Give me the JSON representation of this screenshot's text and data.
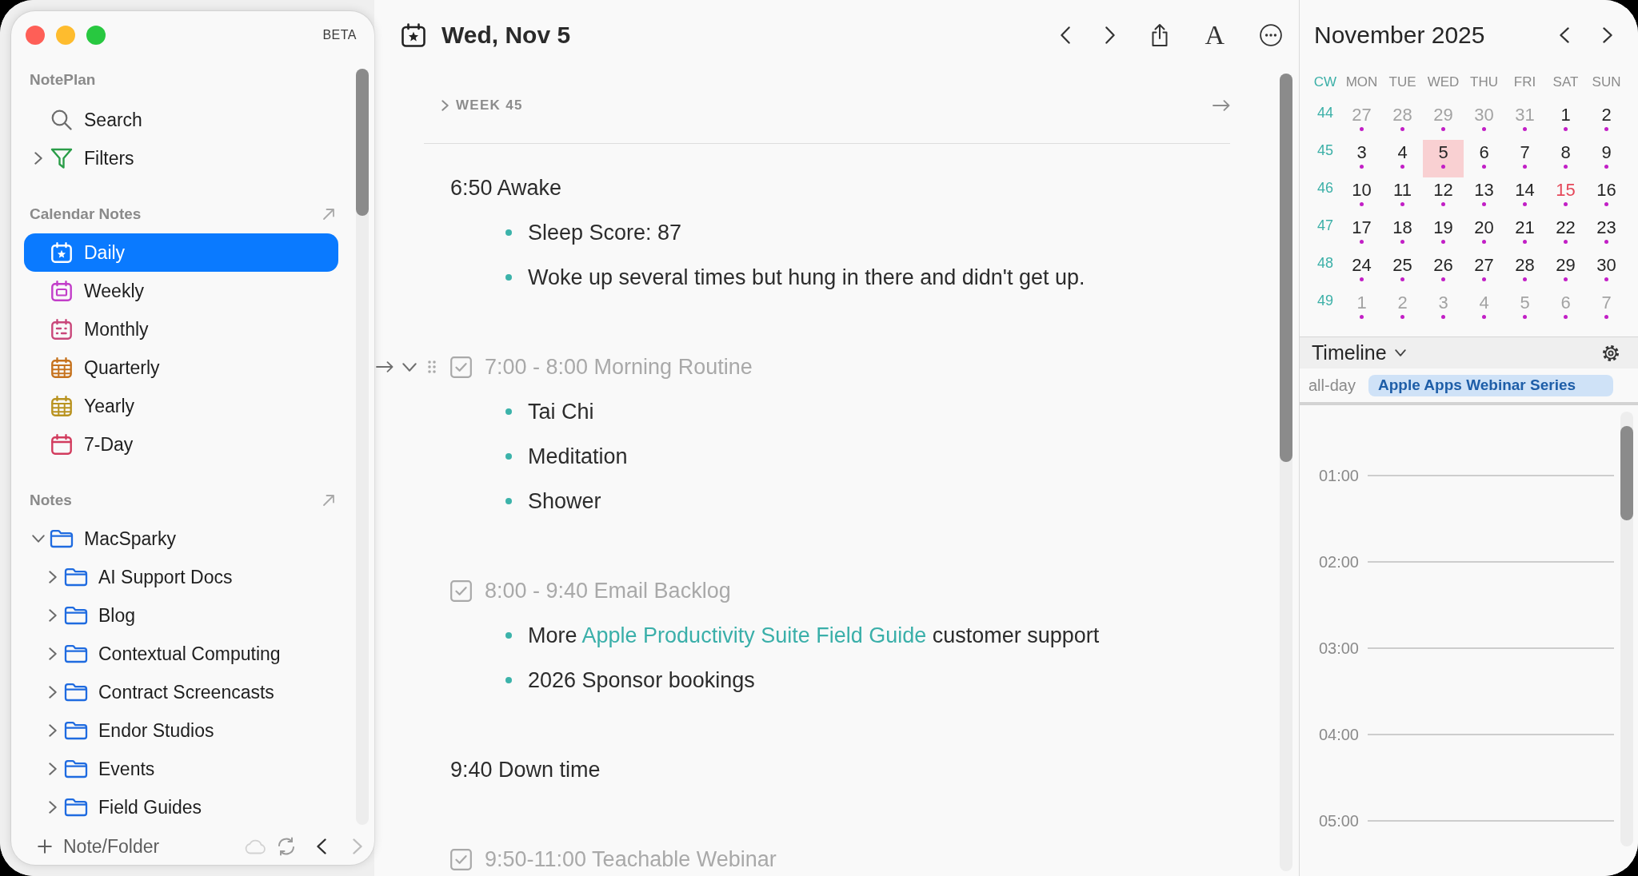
{
  "sidebar": {
    "badge": "BETA",
    "app_section": {
      "title": "NotePlan",
      "items": [
        {
          "kind": "search",
          "label": "Search"
        },
        {
          "kind": "filters",
          "label": "Filters",
          "expanded": false
        }
      ]
    },
    "calendar_notes": {
      "title": "Calendar Notes",
      "items": [
        {
          "kind": "daily",
          "label": "Daily",
          "selected": true
        },
        {
          "kind": "weekly",
          "label": "Weekly",
          "selected": false
        },
        {
          "kind": "monthly",
          "label": "Monthly",
          "selected": false
        },
        {
          "kind": "quarterly",
          "label": "Quarterly",
          "selected": false
        },
        {
          "kind": "yearly",
          "label": "Yearly",
          "selected": false
        },
        {
          "kind": "seven_day",
          "label": "7-Day",
          "selected": false
        }
      ]
    },
    "notes": {
      "title": "Notes",
      "folders": [
        {
          "label": "MacSparky",
          "expanded": true,
          "children": [
            {
              "label": "AI Support Docs",
              "expanded": false
            },
            {
              "label": "Blog",
              "expanded": false
            },
            {
              "label": "Contextual Computing",
              "expanded": false
            },
            {
              "label": "Contract Screencasts",
              "expanded": false
            },
            {
              "label": "Endor Studios",
              "expanded": false
            },
            {
              "label": "Events",
              "expanded": false
            },
            {
              "label": "Field Guides",
              "expanded": false
            }
          ]
        }
      ]
    },
    "footer": {
      "add_label": "Note/Folder",
      "back_disabled": false,
      "forward_disabled": true
    }
  },
  "note": {
    "title": "Wed, Nov 5",
    "format_glyph": "A",
    "week": {
      "label": "WEEK 45",
      "expanded": false
    },
    "sections": [
      {
        "kind": "text",
        "text": "6:50 Awake",
        "hovered": false,
        "bullets": [
          {
            "text": "Sleep Score: 87"
          },
          {
            "text": "Woke up several times but hung in there and didn't get up."
          }
        ]
      },
      {
        "kind": "task",
        "text": "7:00 - 8:00 Morning Routine",
        "checked": true,
        "hovered": true,
        "bullets": [
          {
            "text": "Tai Chi"
          },
          {
            "text": "Meditation"
          },
          {
            "text": "Shower"
          }
        ]
      },
      {
        "kind": "task",
        "text": "8:00 - 9:40 Email Backlog",
        "checked": true,
        "hovered": false,
        "bullets": [
          {
            "text": "More",
            "link": "Apple Productivity Suite Field Guide",
            "after": "customer support"
          },
          {
            "text": "2026 Sponsor bookings"
          }
        ]
      },
      {
        "kind": "text",
        "text": "9:40 Down time",
        "hovered": false
      },
      {
        "kind": "task",
        "text": "9:50-11:00 Teachable Webinar",
        "checked": true,
        "hovered": false
      }
    ]
  },
  "calendar": {
    "title": "November 2025",
    "week_column_label": "CW",
    "weekdays": [
      "MON",
      "TUE",
      "WED",
      "THU",
      "FRI",
      "SAT",
      "SUN"
    ],
    "weeks": [
      {
        "cw": "44",
        "days": [
          {
            "day": "27",
            "outside_month": true,
            "selected": false,
            "today": false,
            "dot": true
          },
          {
            "day": "28",
            "outside_month": true,
            "selected": false,
            "today": false,
            "dot": true
          },
          {
            "day": "29",
            "outside_month": true,
            "selected": false,
            "today": false,
            "dot": true
          },
          {
            "day": "30",
            "outside_month": true,
            "selected": false,
            "today": false,
            "dot": true
          },
          {
            "day": "31",
            "outside_month": true,
            "selected": false,
            "today": false,
            "dot": true
          },
          {
            "day": "1",
            "outside_month": false,
            "selected": false,
            "today": false,
            "dot": true
          },
          {
            "day": "2",
            "outside_month": false,
            "selected": false,
            "today": false,
            "dot": true
          }
        ]
      },
      {
        "cw": "45",
        "days": [
          {
            "day": "3",
            "outside_month": false,
            "selected": false,
            "today": false,
            "dot": true
          },
          {
            "day": "4",
            "outside_month": false,
            "selected": false,
            "today": false,
            "dot": true
          },
          {
            "day": "5",
            "outside_month": false,
            "selected": true,
            "today": false,
            "dot": true
          },
          {
            "day": "6",
            "outside_month": false,
            "selected": false,
            "today": false,
            "dot": true
          },
          {
            "day": "7",
            "outside_month": false,
            "selected": false,
            "today": false,
            "dot": true
          },
          {
            "day": "8",
            "outside_month": false,
            "selected": false,
            "today": false,
            "dot": true
          },
          {
            "day": "9",
            "outside_month": false,
            "selected": false,
            "today": false,
            "dot": true
          }
        ]
      },
      {
        "cw": "46",
        "days": [
          {
            "day": "10",
            "outside_month": false,
            "selected": false,
            "today": false,
            "dot": true
          },
          {
            "day": "11",
            "outside_month": false,
            "selected": false,
            "today": false,
            "dot": true
          },
          {
            "day": "12",
            "outside_month": false,
            "selected": false,
            "today": false,
            "dot": true
          },
          {
            "day": "13",
            "outside_month": false,
            "selected": false,
            "today": false,
            "dot": true
          },
          {
            "day": "14",
            "outside_month": false,
            "selected": false,
            "today": false,
            "dot": true
          },
          {
            "day": "15",
            "outside_month": false,
            "selected": false,
            "today": true,
            "dot": true
          },
          {
            "day": "16",
            "outside_month": false,
            "selected": false,
            "today": false,
            "dot": true
          }
        ]
      },
      {
        "cw": "47",
        "days": [
          {
            "day": "17",
            "outside_month": false,
            "selected": false,
            "today": false,
            "dot": true
          },
          {
            "day": "18",
            "outside_month": false,
            "selected": false,
            "today": false,
            "dot": true
          },
          {
            "day": "19",
            "outside_month": false,
            "selected": false,
            "today": false,
            "dot": true
          },
          {
            "day": "20",
            "outside_month": false,
            "selected": false,
            "today": false,
            "dot": true
          },
          {
            "day": "21",
            "outside_month": false,
            "selected": false,
            "today": false,
            "dot": true
          },
          {
            "day": "22",
            "outside_month": false,
            "selected": false,
            "today": false,
            "dot": true
          },
          {
            "day": "23",
            "outside_month": false,
            "selected": false,
            "today": false,
            "dot": true
          }
        ]
      },
      {
        "cw": "48",
        "days": [
          {
            "day": "24",
            "outside_month": false,
            "selected": false,
            "today": false,
            "dot": true
          },
          {
            "day": "25",
            "outside_month": false,
            "selected": false,
            "today": false,
            "dot": true
          },
          {
            "day": "26",
            "outside_month": false,
            "selected": false,
            "today": false,
            "dot": true
          },
          {
            "day": "27",
            "outside_month": false,
            "selected": false,
            "today": false,
            "dot": true
          },
          {
            "day": "28",
            "outside_month": false,
            "selected": false,
            "today": false,
            "dot": true
          },
          {
            "day": "29",
            "outside_month": false,
            "selected": false,
            "today": false,
            "dot": true
          },
          {
            "day": "30",
            "outside_month": false,
            "selected": false,
            "today": false,
            "dot": true
          }
        ]
      },
      {
        "cw": "49",
        "days": [
          {
            "day": "1",
            "outside_month": true,
            "selected": false,
            "today": false,
            "dot": true
          },
          {
            "day": "2",
            "outside_month": true,
            "selected": false,
            "today": false,
            "dot": true
          },
          {
            "day": "3",
            "outside_month": true,
            "selected": false,
            "today": false,
            "dot": true
          },
          {
            "day": "4",
            "outside_month": true,
            "selected": false,
            "today": false,
            "dot": true
          },
          {
            "day": "5",
            "outside_month": true,
            "selected": false,
            "today": false,
            "dot": true
          },
          {
            "day": "6",
            "outside_month": true,
            "selected": false,
            "today": false,
            "dot": true
          },
          {
            "day": "7",
            "outside_month": true,
            "selected": false,
            "today": false,
            "dot": true
          }
        ]
      }
    ]
  },
  "timeline": {
    "title": "Timeline",
    "all_day_label": "all-day",
    "all_day_events": [
      "Apple Apps Webinar Series"
    ],
    "hours": [
      "01:00",
      "02:00",
      "03:00",
      "04:00",
      "05:00"
    ]
  }
}
